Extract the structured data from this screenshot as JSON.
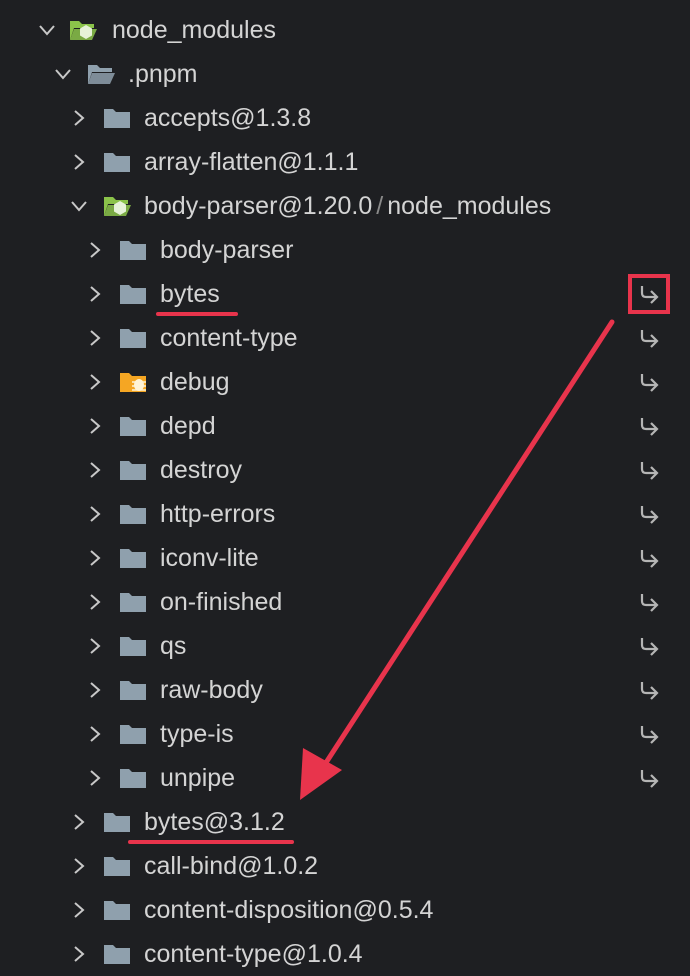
{
  "tree": [
    {
      "label": "node_modules",
      "depth": 0,
      "expanded": true,
      "icon": "node-folder-open-icon"
    },
    {
      "label": ".pnpm",
      "depth": 1,
      "expanded": true,
      "icon": "folder-open-icon"
    },
    {
      "label": "accepts@1.3.8",
      "depth": 2,
      "expanded": false,
      "icon": "folder-icon"
    },
    {
      "label": "array-flatten@1.1.1",
      "depth": 2,
      "expanded": false,
      "icon": "folder-icon"
    },
    {
      "label": "body-parser@1.20.0",
      "suffix": "node_modules",
      "separator": "/",
      "depth": 2,
      "expanded": true,
      "icon": "node-folder-open-icon"
    },
    {
      "label": "body-parser",
      "depth": 3,
      "expanded": false,
      "icon": "folder-icon",
      "symlink": false
    },
    {
      "label": "bytes",
      "depth": 3,
      "expanded": false,
      "icon": "folder-icon",
      "symlink": true
    },
    {
      "label": "content-type",
      "depth": 3,
      "expanded": false,
      "icon": "folder-icon",
      "symlink": true
    },
    {
      "label": "debug",
      "depth": 3,
      "expanded": false,
      "icon": "debug-folder-icon",
      "symlink": true
    },
    {
      "label": "depd",
      "depth": 3,
      "expanded": false,
      "icon": "folder-icon",
      "symlink": true
    },
    {
      "label": "destroy",
      "depth": 3,
      "expanded": false,
      "icon": "folder-icon",
      "symlink": true
    },
    {
      "label": "http-errors",
      "depth": 3,
      "expanded": false,
      "icon": "folder-icon",
      "symlink": true
    },
    {
      "label": "iconv-lite",
      "depth": 3,
      "expanded": false,
      "icon": "folder-icon",
      "symlink": true
    },
    {
      "label": "on-finished",
      "depth": 3,
      "expanded": false,
      "icon": "folder-icon",
      "symlink": true
    },
    {
      "label": "qs",
      "depth": 3,
      "expanded": false,
      "icon": "folder-icon",
      "symlink": true
    },
    {
      "label": "raw-body",
      "depth": 3,
      "expanded": false,
      "icon": "folder-icon",
      "symlink": true
    },
    {
      "label": "type-is",
      "depth": 3,
      "expanded": false,
      "icon": "folder-icon",
      "symlink": true
    },
    {
      "label": "unpipe",
      "depth": 3,
      "expanded": false,
      "icon": "folder-icon",
      "symlink": true
    },
    {
      "label": "bytes@3.1.2",
      "depth": 2,
      "expanded": false,
      "icon": "folder-icon"
    },
    {
      "label": "call-bind@1.0.2",
      "depth": 2,
      "expanded": false,
      "icon": "folder-icon"
    },
    {
      "label": "content-disposition@0.5.4",
      "depth": 2,
      "expanded": false,
      "icon": "folder-icon"
    },
    {
      "label": "content-type@1.0.4",
      "depth": 2,
      "expanded": false,
      "icon": "folder-icon"
    }
  ],
  "annotations": {
    "color": "#e8344c",
    "underlined_items": [
      "bytes",
      "bytes@3.1.2"
    ],
    "highlighted_symlink_of": "bytes",
    "arrow": "from bytes symlink icon to bytes@3.1.2"
  },
  "colors": {
    "background": "#1e1f22",
    "text": "#d4d4d4",
    "folder": "#8fa0ad",
    "node_folder": "#8bc34a",
    "debug_folder": "#f5a623"
  }
}
